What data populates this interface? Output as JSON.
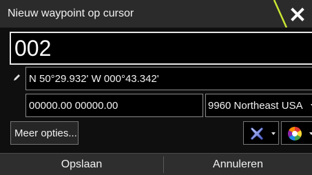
{
  "dialog": {
    "title": "Nieuw waypoint op cursor",
    "close_icon": "close-x-icon",
    "accent_color": "#c8e632"
  },
  "waypoint": {
    "name": "002",
    "position": "N 50°29.932'   W 000°43.342'",
    "loran_td": "00000.00  00000.00",
    "loran_chain": "9960 Northeast USA",
    "edit_icon": "pencil-icon"
  },
  "options": {
    "more_label": "Meer opties...",
    "symbol_icon": "waypoint-x-symbol-icon",
    "color_icon": "color-wheel-icon"
  },
  "footer": {
    "save_label": "Opslaan",
    "cancel_label": "Annuleren"
  }
}
